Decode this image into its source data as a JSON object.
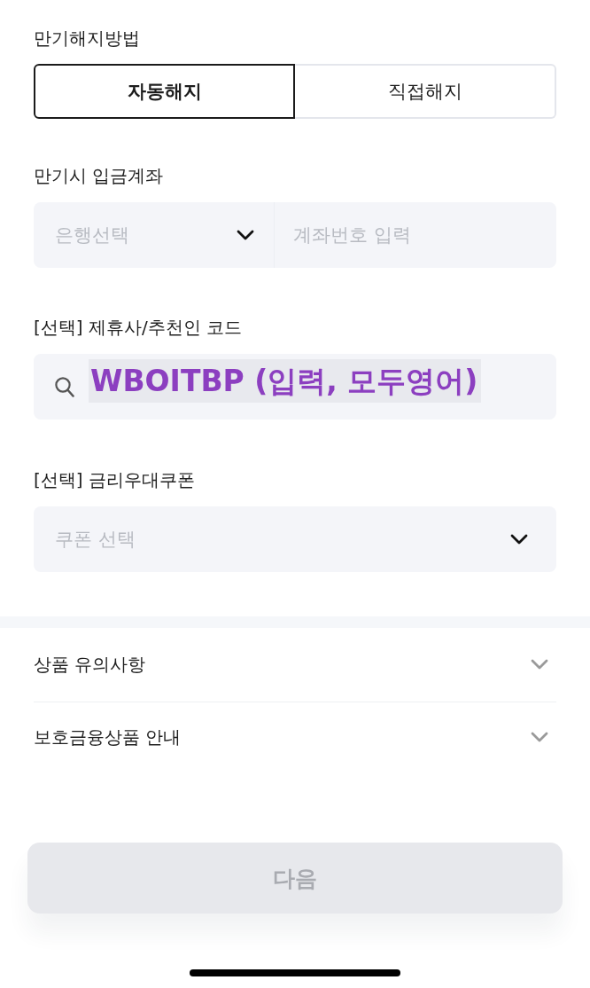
{
  "maturity_method": {
    "label": "만기해지방법",
    "options": [
      {
        "label": "자동해지",
        "selected": true
      },
      {
        "label": "직접해지",
        "selected": false
      }
    ]
  },
  "deposit_account": {
    "label": "만기시 입금계좌",
    "bank_select": {
      "placeholder": "은행선택"
    },
    "account_number": {
      "placeholder": "계좌번호 입력"
    }
  },
  "referral_code": {
    "label": "[선택] 제휴사/추천인 코드",
    "annotation": "WBOITBP (입력, 모두영어)"
  },
  "coupon": {
    "label": "[선택] 금리우대쿠폰",
    "select": {
      "placeholder": "쿠폰 선택"
    }
  },
  "accordions": [
    {
      "title": "상품 유의사항",
      "expanded": false
    },
    {
      "title": "보호금융상품 안내",
      "expanded": false
    }
  ],
  "next_button": {
    "label": "다음",
    "disabled": true
  }
}
